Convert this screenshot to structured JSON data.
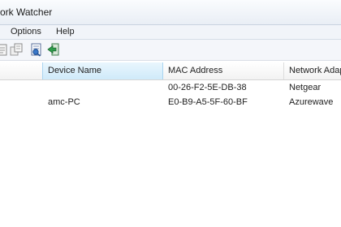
{
  "window": {
    "title": "ork Watcher"
  },
  "menu": {
    "items": [
      "Options",
      "Help"
    ]
  },
  "toolbar": {
    "buttons": [
      {
        "icon": "properties-icon"
      },
      {
        "icon": "copy-icon"
      },
      {
        "icon": "save-html-report-icon"
      },
      {
        "icon": "exit-icon"
      }
    ]
  },
  "table": {
    "columns": [
      "",
      "Device Name",
      "MAC Address",
      "Network Adapter"
    ],
    "rows": [
      {
        "device_name": "",
        "mac_address": "00-26-F2-5E-DB-38",
        "network_adapter": "Netgear"
      },
      {
        "device_name": "amc-PC",
        "mac_address": "E0-B9-A5-5F-60-BF",
        "network_adapter": "Azurewave"
      }
    ]
  },
  "colors": {
    "titlebar": "#eef2f8",
    "menubar": "#f1f4f9",
    "header_selected": "#d7eefb",
    "exit_icon": "#2e9d4a"
  }
}
